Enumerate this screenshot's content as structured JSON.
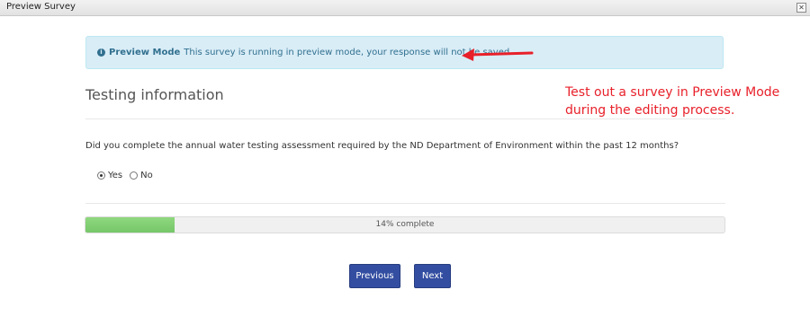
{
  "window": {
    "title": "Preview Survey",
    "close_symbol": "✕"
  },
  "alert": {
    "icon": "info-icon",
    "icon_glyph": "i",
    "strong": "Preview Mode",
    "message": "This survey is running in preview mode, your response will not be saved."
  },
  "section": {
    "title": "Testing information"
  },
  "callout": {
    "text": "Test out a survey in Preview Mode during the editing process.",
    "color": "#e8202a"
  },
  "question": {
    "text": "Did you complete the annual water testing assessment required by the ND Department of Environment within the past 12 months?",
    "options": [
      {
        "label": "Yes",
        "selected": true
      },
      {
        "label": "No",
        "selected": false
      }
    ]
  },
  "progress": {
    "percent": 14,
    "label": "14% complete",
    "color": "#76c769"
  },
  "nav": {
    "previous": "Previous",
    "next": "Next",
    "button_color": "#334ea1"
  }
}
